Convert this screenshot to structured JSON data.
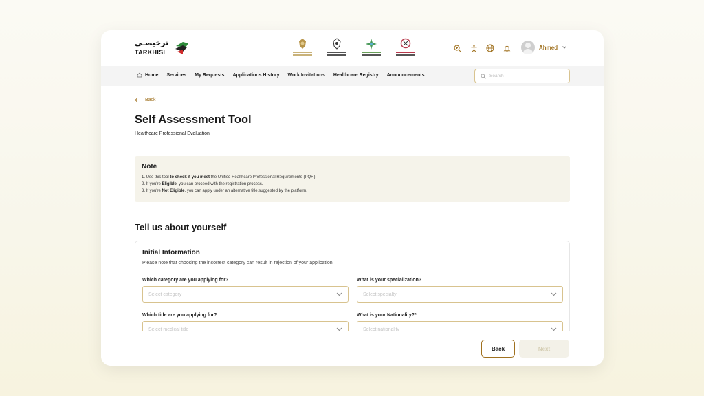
{
  "brand": {
    "logo_arabic": "ترخيصـي",
    "logo_english": "TARKHISI",
    "colors": {
      "accent": "#a0711f",
      "accent_border": "#d8c38f",
      "note_bg": "#f5f3ea"
    }
  },
  "header": {
    "gov_logos": [
      "uae-emblem-logo",
      "abu-dhabi-department-of-health-logo",
      "abu-dhabi-health-services-logo",
      "medical-council-logo"
    ],
    "icons": [
      "zoom-icon",
      "accessibility-icon",
      "globe-icon",
      "bell-icon"
    ],
    "user_name": "Ahmed"
  },
  "nav": {
    "items": [
      {
        "label": "Home",
        "icon": "home-icon"
      },
      {
        "label": "Services"
      },
      {
        "label": "My Requests"
      },
      {
        "label": "Applications History"
      },
      {
        "label": "Work Invitations"
      },
      {
        "label": "Healthcare Registry"
      },
      {
        "label": "Announcements"
      }
    ],
    "search_placeholder": "Search"
  },
  "main": {
    "back_label": "Back",
    "title": "Self Assessment Tool",
    "subtitle": "Healthcare Professional Evaluation",
    "note": {
      "title": "Note",
      "item1_a": "1. Use this tool ",
      "item1_b": "to check if you meet",
      "item1_c": " the Unified Healthcare Professional Requirements (PQR).",
      "item2_a": "2. If you're ",
      "item2_b": "Eligible",
      "item2_c": ", you can proceed with the registration process.",
      "item3_a": "3. If you're ",
      "item3_b": "Not Eligible",
      "item3_c": ", you can apply under an alternative title suggested by the platform."
    },
    "section_title": "Tell us about yourself",
    "form": {
      "title": "Initial Information",
      "description": "Please note that choosing the incorrect category can result in rejection of your application.",
      "fields": [
        {
          "label": "Which category are you applying for?",
          "placeholder": "Select category"
        },
        {
          "label": "What is your specialization?",
          "placeholder": "Select specialty"
        },
        {
          "label": "Which title are you applying for?",
          "placeholder": "Select medical title"
        },
        {
          "label": "What is your Nationality?*",
          "placeholder": "Select nationality"
        }
      ]
    }
  },
  "footer": {
    "back_label": "Back",
    "next_label": "Next"
  }
}
